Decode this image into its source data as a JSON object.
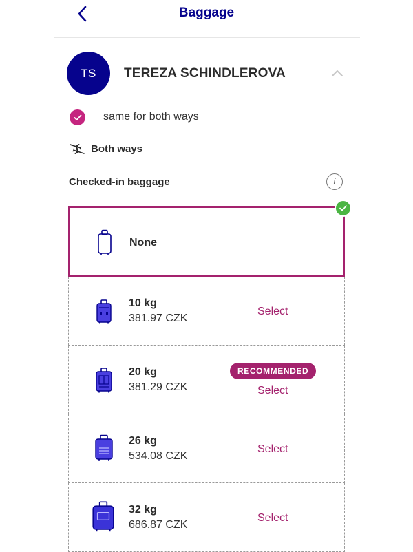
{
  "header": {
    "title": "Baggage"
  },
  "passenger": {
    "initials": "TS",
    "name": "TEREZA SCHINDLEROVA"
  },
  "same_both_ways": {
    "label": "same for both ways",
    "checked": true
  },
  "direction": {
    "label": "Both ways"
  },
  "section": {
    "title": "Checked-in baggage"
  },
  "options": [
    {
      "label": "None",
      "selected": true
    },
    {
      "weight": "10 kg",
      "price": "381.97 CZK",
      "action": "Select"
    },
    {
      "weight": "20 kg",
      "price": "381.29 CZK",
      "action": "Select",
      "badge": "RECOMMENDED"
    },
    {
      "weight": "26 kg",
      "price": "534.08 CZK",
      "action": "Select"
    },
    {
      "weight": "32 kg",
      "price": "686.87 CZK",
      "action": "Select"
    }
  ],
  "colors": {
    "brand": "#06038d",
    "accent": "#a4226d",
    "success": "#4bb543"
  }
}
